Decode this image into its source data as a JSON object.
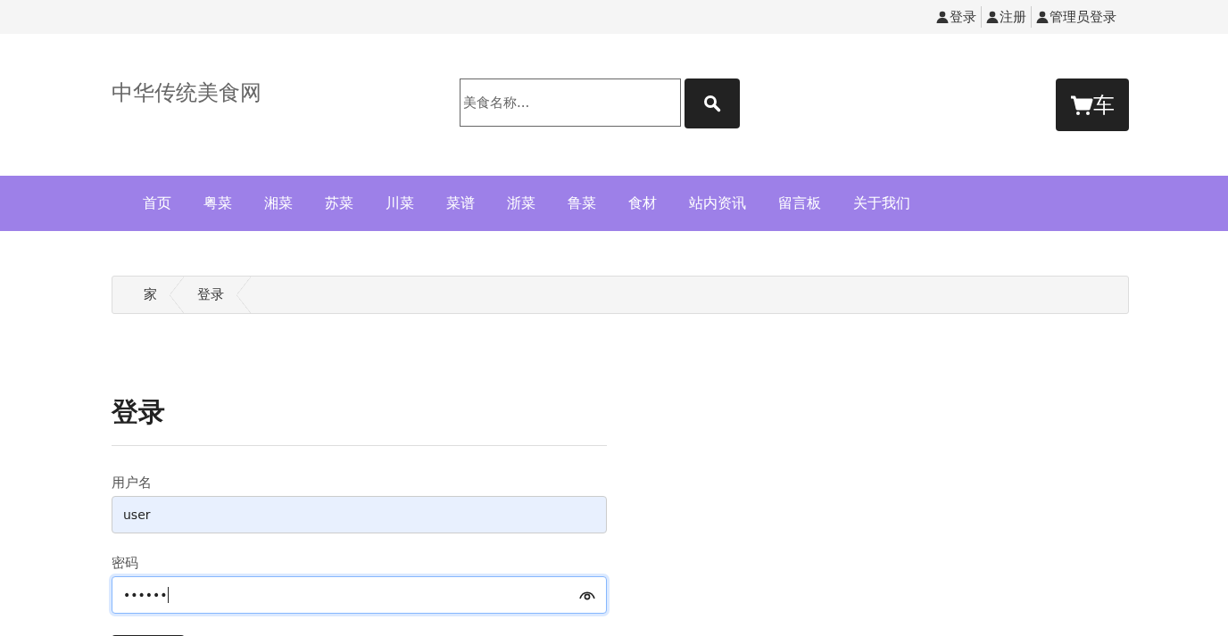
{
  "top_links": [
    {
      "label": "登录"
    },
    {
      "label": "注册"
    },
    {
      "label": "管理员登录"
    }
  ],
  "site_title": "中华传统美食网",
  "search": {
    "placeholder": "美食名称..."
  },
  "cart": {
    "label": "车"
  },
  "nav": [
    {
      "label": "首页"
    },
    {
      "label": "粤菜"
    },
    {
      "label": "湘菜"
    },
    {
      "label": "苏菜"
    },
    {
      "label": "川菜"
    },
    {
      "label": "菜谱"
    },
    {
      "label": "浙菜"
    },
    {
      "label": "鲁菜"
    },
    {
      "label": "食材"
    },
    {
      "label": "站内资讯"
    },
    {
      "label": "留言板"
    },
    {
      "label": "关于我们"
    }
  ],
  "breadcrumb": [
    {
      "label": "家"
    },
    {
      "label": "登录"
    }
  ],
  "form": {
    "heading": "登录",
    "fields": [
      {
        "label": "用户名",
        "value": "user",
        "kind": "text",
        "focused": false
      },
      {
        "label": "密码",
        "value": "••••••",
        "kind": "password",
        "focused": true
      }
    ]
  }
}
